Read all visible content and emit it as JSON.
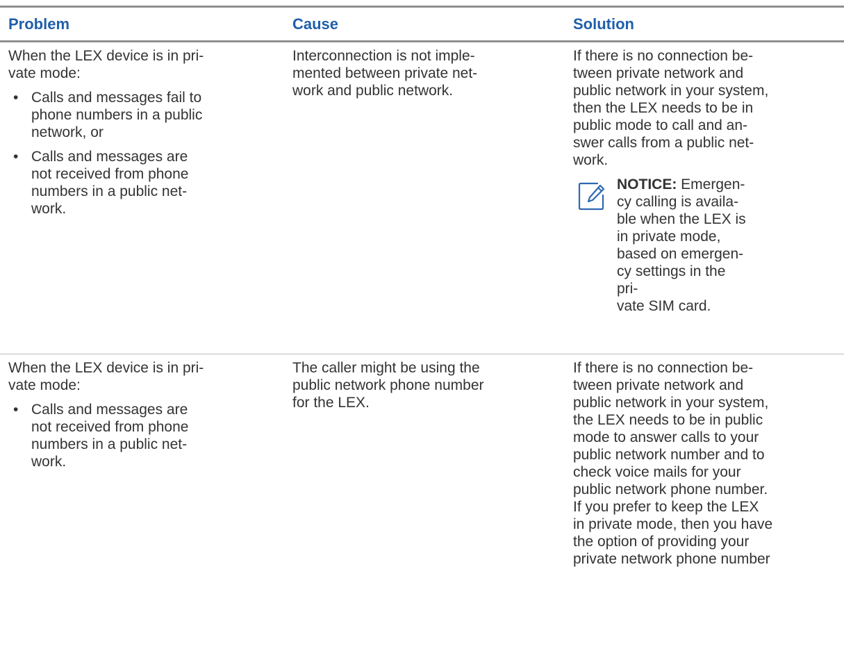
{
  "colors": {
    "header_text": "#1f5fa9",
    "body_text": "#333333",
    "rule": "#8f8f8f",
    "notice_icon": "#2c68b0"
  },
  "table": {
    "headers": {
      "problem": "Problem",
      "cause": "Cause",
      "solution": "Solution"
    },
    "rows": [
      {
        "problem_intro": "When the LEX device is in pri-\nvate mode:",
        "problem_bullets": [
          "Calls and messages fail to\nphone numbers in a public\nnetwork, or",
          "Calls and messages are\nnot received from phone\nnumbers in a public net-\nwork."
        ],
        "cause": "Interconnection is not imple-\nmented between private net-\nwork and public network.",
        "solution": "If there is no connection be-\ntween private network and\npublic network in your system,\nthen the LEX needs to be in\npublic mode to call and an-\nswer calls from a public net-\nwork.",
        "notice_label": "NOTICE:",
        "notice_text": " Emergen-\ncy calling is availa-\nble when the LEX is\nin private mode,\nbased on emergen-\ncy settings in the pri-\nvate SIM card.",
        "notice_icon": "edit-note-icon"
      },
      {
        "problem_intro": "When the LEX device is in pri-\nvate mode:",
        "problem_bullets": [
          "Calls and messages are\nnot received from phone\nnumbers in a public net-\nwork."
        ],
        "cause": "The caller might be using the\npublic network phone number\nfor the LEX.",
        "solution": "If there is no connection be-\ntween private network and\npublic network in your system,\nthe LEX needs to be in public\nmode to answer calls to your\npublic network number and to\ncheck voice mails for your\npublic network phone number.\nIf you prefer to keep the LEX\nin private mode, then you have\nthe option of providing your\nprivate network phone number"
      }
    ],
    "bullet_glyph": "•"
  }
}
